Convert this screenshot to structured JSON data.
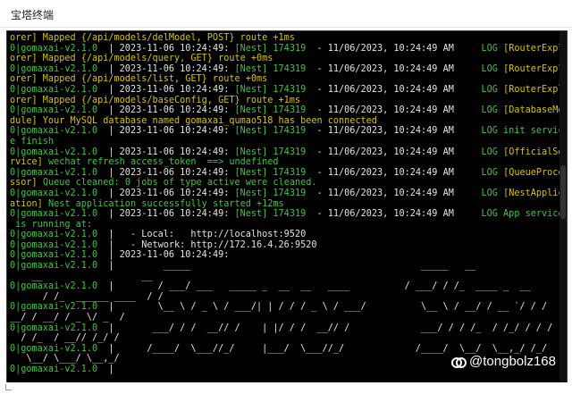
{
  "window": {
    "title": "宝塔终端"
  },
  "terminal": {
    "lines": [
      [
        {
          "t": "orer] Mapped {/api/models/delModel, POST} route +1ms",
          "c": "y"
        }
      ],
      [
        {
          "t": "0|gomaxai-v2.1.0  ",
          "c": "g"
        },
        {
          "t": "| 2023-11-06 10:24:49: ",
          "c": "w"
        },
        {
          "t": "[Nest] 174319  ",
          "c": "g"
        },
        {
          "t": "- 11/06/2023, 10:24:49 AM     ",
          "c": "w"
        },
        {
          "t": "LOG ",
          "c": "g"
        },
        {
          "t": "[RouterExpl",
          "c": "y"
        }
      ],
      [
        {
          "t": "orer] Mapped {/api/models/query, GET} route +0ms",
          "c": "y"
        }
      ],
      [
        {
          "t": "0|gomaxai-v2.1.0  ",
          "c": "g"
        },
        {
          "t": "| 2023-11-06 10:24:49: ",
          "c": "w"
        },
        {
          "t": "[Nest] 174319  ",
          "c": "g"
        },
        {
          "t": "- 11/06/2023, 10:24:49 AM     ",
          "c": "w"
        },
        {
          "t": "LOG ",
          "c": "g"
        },
        {
          "t": "[RouterExpl",
          "c": "y"
        }
      ],
      [
        {
          "t": "orer] Mapped {/api/models/list, GET} route +0ms",
          "c": "y"
        }
      ],
      [
        {
          "t": "0|gomaxai-v2.1.0  ",
          "c": "g"
        },
        {
          "t": "| 2023-11-06 10:24:49: ",
          "c": "w"
        },
        {
          "t": "[Nest] 174319  ",
          "c": "g"
        },
        {
          "t": "- 11/06/2023, 10:24:49 AM     ",
          "c": "w"
        },
        {
          "t": "LOG ",
          "c": "g"
        },
        {
          "t": "[RouterExpl",
          "c": "y"
        }
      ],
      [
        {
          "t": "orer] Mapped {/api/models/baseConfig, GET} route +1ms",
          "c": "y"
        }
      ],
      [
        {
          "t": "0|gomaxai-v2.1.0  ",
          "c": "g"
        },
        {
          "t": "| 2023-11-06 10:24:49: ",
          "c": "w"
        },
        {
          "t": "[Nest] 174319  ",
          "c": "g"
        },
        {
          "t": "- 11/06/2023, 10:24:49 AM     ",
          "c": "w"
        },
        {
          "t": "LOG ",
          "c": "g"
        },
        {
          "t": "[DatabaseMo",
          "c": "y"
        }
      ],
      [
        {
          "t": "dule] Your MySQL database named gomaxai_qumao518 has been connected",
          "c": "y"
        }
      ],
      [
        {
          "t": "0|gomaxai-v2.1.0  ",
          "c": "g"
        },
        {
          "t": "| 2023-11-06 10:24:49: ",
          "c": "w"
        },
        {
          "t": "[Nest] 174319  ",
          "c": "g"
        },
        {
          "t": "- 11/06/2023, 10:24:49 AM     ",
          "c": "w"
        },
        {
          "t": "LOG init servic",
          "c": "g"
        }
      ],
      [
        {
          "t": "e finish",
          "c": "g"
        }
      ],
      [
        {
          "t": "0|gomaxai-v2.1.0  ",
          "c": "g"
        },
        {
          "t": "| 2023-11-06 10:24:49: ",
          "c": "w"
        },
        {
          "t": "[Nest] 174319  ",
          "c": "g"
        },
        {
          "t": "- 11/06/2023, 10:24:49 AM     ",
          "c": "w"
        },
        {
          "t": "LOG ",
          "c": "g"
        },
        {
          "t": "[OfficialSe",
          "c": "y"
        }
      ],
      [
        {
          "t": "rvice] ",
          "c": "y"
        },
        {
          "t": "wechat refresh access_token  ==> undefined",
          "c": "g"
        }
      ],
      [
        {
          "t": "0|gomaxai-v2.1.0  ",
          "c": "g"
        },
        {
          "t": "| 2023-11-06 10:24:49: ",
          "c": "w"
        },
        {
          "t": "[Nest] 174319  ",
          "c": "g"
        },
        {
          "t": "- 11/06/2023, 10:24:49 AM     ",
          "c": "w"
        },
        {
          "t": "LOG ",
          "c": "g"
        },
        {
          "t": "[QueueProce",
          "c": "y"
        }
      ],
      [
        {
          "t": "ssor] ",
          "c": "y"
        },
        {
          "t": "Queue cleaned: 0 jobs of type active were cleaned.",
          "c": "g"
        }
      ],
      [
        {
          "t": "0|gomaxai-v2.1.0  ",
          "c": "g"
        },
        {
          "t": "| 2023-11-06 10:24:49: ",
          "c": "w"
        },
        {
          "t": "[Nest] 174319  ",
          "c": "g"
        },
        {
          "t": "- 11/06/2023, 10:24:49 AM     ",
          "c": "w"
        },
        {
          "t": "LOG ",
          "c": "g"
        },
        {
          "t": "[NestApplic",
          "c": "y"
        }
      ],
      [
        {
          "t": "ation] ",
          "c": "y"
        },
        {
          "t": "Nest application successfully started +12ms",
          "c": "g"
        }
      ],
      [
        {
          "t": "0|gomaxai-v2.1.0  ",
          "c": "g"
        },
        {
          "t": "| 2023-11-06 10:24:49: ",
          "c": "w"
        },
        {
          "t": "[Nest] 174319  ",
          "c": "g"
        },
        {
          "t": "- 11/06/2023, 10:24:49 AM     ",
          "c": "w"
        },
        {
          "t": "LOG App service",
          "c": "g"
        }
      ],
      [
        {
          "t": " is running at:",
          "c": "g"
        }
      ],
      [
        {
          "t": "0|gomaxai-v2.1.0  ",
          "c": "g"
        },
        {
          "t": "|   - Local:   http://localhost:9520",
          "c": "w"
        }
      ],
      [
        {
          "t": "0|gomaxai-v2.1.0  ",
          "c": "g"
        },
        {
          "t": "|   - Network: http://172.16.4.26:9520",
          "c": "w"
        }
      ],
      [
        {
          "t": "0|gomaxai-v2.1.0  ",
          "c": "g"
        },
        {
          "t": "| 2023-11-06 10:24:49:",
          "c": "w"
        }
      ],
      [
        {
          "t": "0|gomaxai-v2.1.0  ",
          "c": "g"
        },
        {
          "t": "|         _____                                          _____   __",
          "c": "w"
        }
      ],
      [
        {
          "t": "    __                  __",
          "c": "w"
        }
      ],
      [
        {
          "t": "0|gomaxai-v2.1.0  ",
          "c": "g"
        },
        {
          "t": "|        / ___/ ___   _____ _  __  __   ____          / ___/ / /_  ____ _  __",
          "c": "w"
        }
      ],
      [
        {
          "t": "      / /_  ______ ____  / /",
          "c": "w"
        }
      ],
      [
        {
          "t": "0|gomaxai-v2.1.0  ",
          "c": "g"
        },
        {
          "t": "|        \\__ \\ / _ \\ / ___/| | / / / _ \\ / ___/          \\__ \\ / __/ / __ `/ / /",
          "c": "w"
        }
      ],
      [
        {
          "t": "__/ / __/ / _ \\/ _  /",
          "c": "w"
        }
      ],
      [
        {
          "t": "0|gomaxai-v2.1.0  ",
          "c": "g"
        },
        {
          "t": "|       ___/ / /  __// /    | |/ / /  __// /             ___/ / / /_  / /_/ / / /",
          "c": "w"
        }
      ],
      [
        {
          "t": "  / /_  / __// /_/ /",
          "c": "w"
        }
      ],
      [
        {
          "t": "0|gomaxai-v2.1.0  ",
          "c": "g"
        },
        {
          "t": "|      /____/  \\___//_/     |___/  \\___//_/             /____/  \\__/  \\__,_/ /_/",
          "c": "w"
        }
      ],
      [
        {
          "t": "   \\__/ \\___/ \\__,_/",
          "c": "w"
        }
      ],
      [
        {
          "t": "0|gomaxai-v2.1.0  ",
          "c": "g"
        },
        {
          "t": "|",
          "c": "w"
        }
      ]
    ]
  },
  "watermark": {
    "text": "@tongbolz168"
  },
  "colors": {
    "yellow": "#d6c400",
    "green": "#3ec43e",
    "white": "#e2e2e2",
    "background": "#000000"
  }
}
